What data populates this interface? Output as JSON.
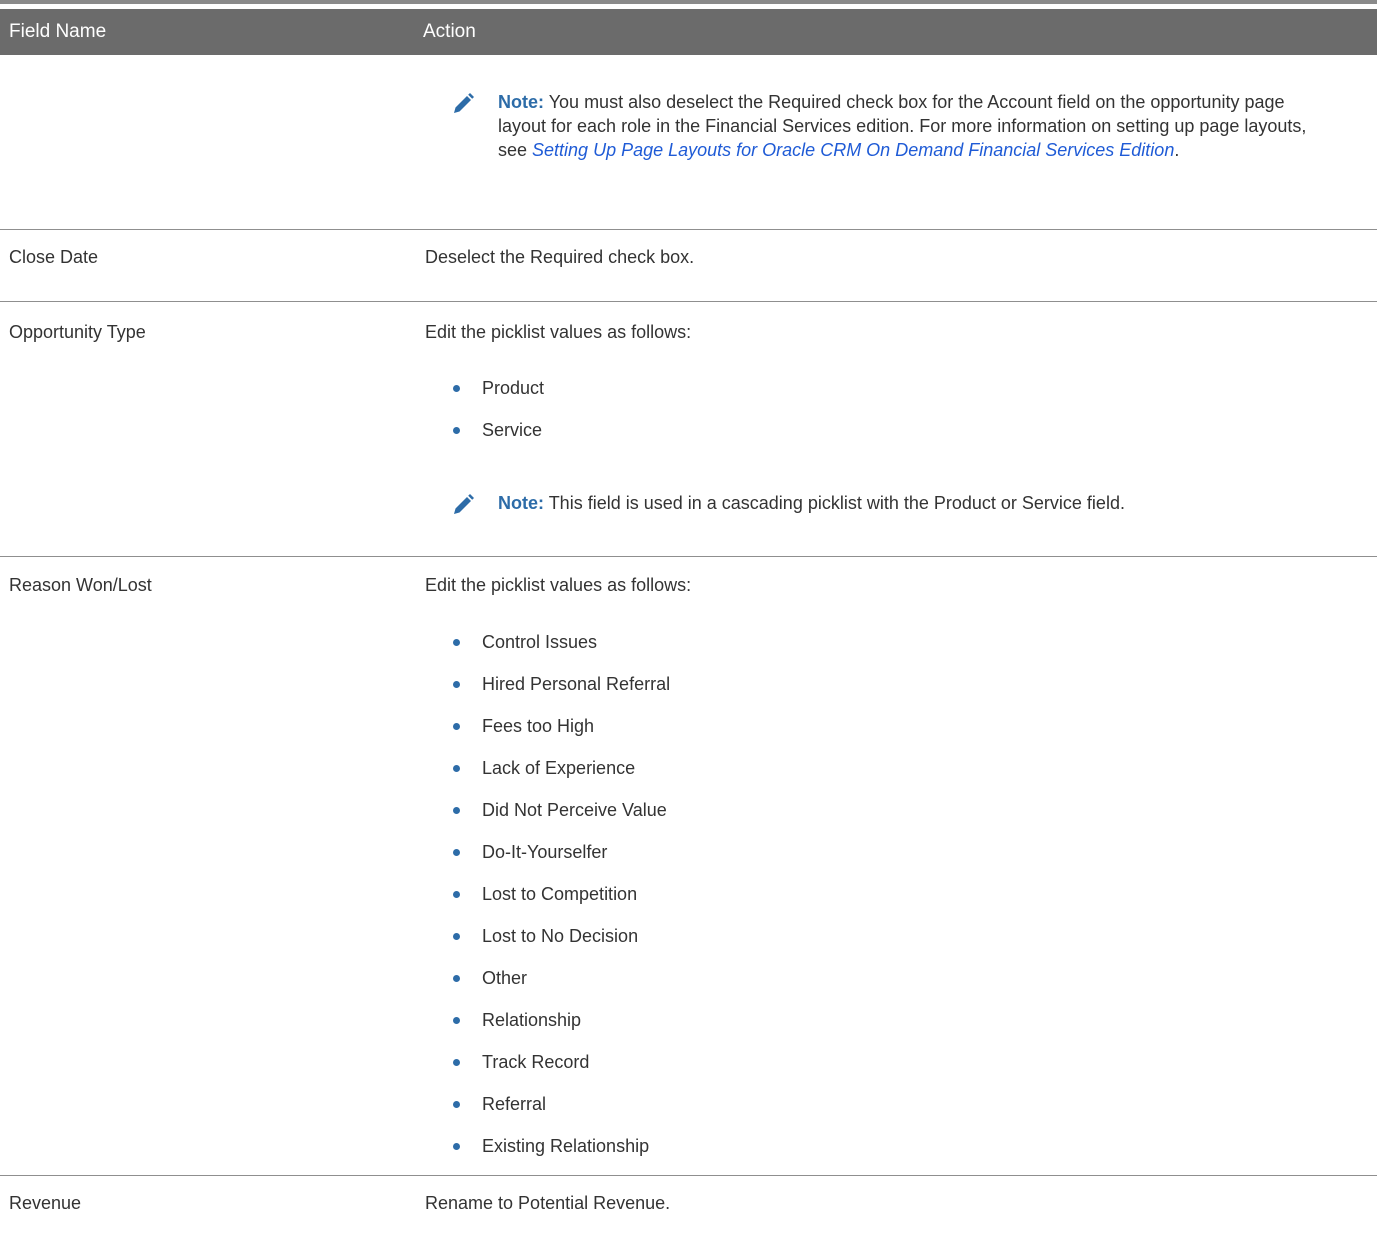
{
  "table": {
    "headers": [
      "Field Name",
      "Action"
    ],
    "rows": [
      {
        "field": "",
        "note": {
          "label": "Note:",
          "text_before": "You must also deselect the Required check box for the Account field on the opportunity page layout for each role in the Financial Services edition. For more information on setting up page layouts, see ",
          "link": "Setting Up Page Layouts for Oracle CRM On Demand Financial Services Edition",
          "text_after": "."
        }
      },
      {
        "field": "Close Date",
        "action": "Deselect the Required check box."
      },
      {
        "field": "Opportunity Type",
        "action": "Edit the picklist values as follows:",
        "items": [
          "Product",
          "Service"
        ],
        "note": {
          "label": "Note:",
          "text": "This field is used in a cascading picklist with the Product or Service field."
        }
      },
      {
        "field": "Reason Won/Lost",
        "action": "Edit the picklist values as follows:",
        "items": [
          "Control Issues",
          "Hired Personal Referral",
          "Fees too High",
          "Lack of Experience",
          "Did Not Perceive Value",
          "Do-It-Yourselfer",
          "Lost to Competition",
          "Lost to No Decision",
          "Other",
          "Relationship",
          "Track Record",
          "Referral",
          "Existing Relationship"
        ]
      },
      {
        "field": "Revenue",
        "action": "Rename to Potential Revenue."
      }
    ]
  },
  "colors": {
    "header_bg": "#6b6b6b",
    "note_label": "#2d6ca8",
    "link": "#1f5bd6",
    "bullet": "#2d6ca8"
  },
  "icons": {
    "note": "pencil-icon",
    "bullet": "bullet-dot"
  }
}
